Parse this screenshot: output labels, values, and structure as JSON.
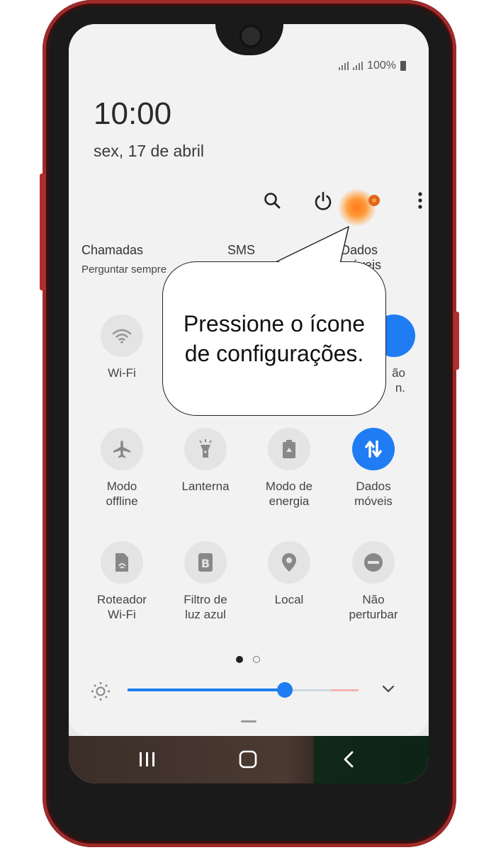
{
  "status": {
    "battery": "100%"
  },
  "clock": {
    "time": "10:00",
    "date": "sex, 17 de abril"
  },
  "top_icons": [
    "search-icon",
    "power-icon",
    "gear-icon",
    "more-icon"
  ],
  "sim": {
    "calls_label": "Chamadas",
    "calls_value": "Perguntar sempre",
    "sms_label": "SMS",
    "data_label": "Dados móveis"
  },
  "tiles": [
    {
      "label": "Wi-Fi",
      "icon": "wifi-icon",
      "active": false
    },
    {
      "label": "",
      "icon": "",
      "active": false
    },
    {
      "label": "",
      "icon": "",
      "active": false
    },
    {
      "label": "ão\nn.",
      "icon": "",
      "active": true
    },
    {
      "label": "Modo\noffline",
      "icon": "airplane-icon",
      "active": false
    },
    {
      "label": "Lanterna",
      "icon": "flashlight-icon",
      "active": false
    },
    {
      "label": "Modo de\nenergia",
      "icon": "battery-recycle-icon",
      "active": false
    },
    {
      "label": "Dados\nmóveis",
      "icon": "data-arrows-icon",
      "active": true
    },
    {
      "label": "Roteador\nWi-Fi",
      "icon": "hotspot-icon",
      "active": false
    },
    {
      "label": "Filtro de\nluz azul",
      "icon": "blue-light-icon",
      "active": false
    },
    {
      "label": "Local",
      "icon": "location-icon",
      "active": false
    },
    {
      "label": "Não\nperturbar",
      "icon": "do-not-disturb-icon",
      "active": false
    }
  ],
  "pages": {
    "current": 1,
    "total": 2
  },
  "brightness": {
    "level_percent": 68
  },
  "callout": {
    "text": "Pressione o ícone de configurações."
  },
  "colors": {
    "accent": "#1f7cf2",
    "highlight": "#ff7a1a",
    "frame": "#a02a2a"
  }
}
